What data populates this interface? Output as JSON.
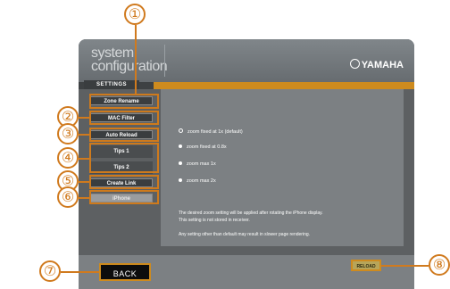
{
  "header": {
    "title_line1": "system",
    "title_line2": "configuration",
    "brand": "YAMAHA"
  },
  "tab": {
    "label": "SETTINGS"
  },
  "sidebar": {
    "items": [
      {
        "label": "Zone Rename"
      },
      {
        "label": "MAC Filter"
      },
      {
        "label": "Auto Reload"
      },
      {
        "label": "Tips 1"
      },
      {
        "label": "Tips 2"
      },
      {
        "label": "Create Link"
      },
      {
        "label": "iPhone"
      }
    ]
  },
  "options": [
    {
      "label": "zoom fixed at 1x (default)",
      "selected": true
    },
    {
      "label": "zoom fixed at 0.8x",
      "selected": false
    },
    {
      "label": "zoom max 1x",
      "selected": false
    },
    {
      "label": "zoom max 2x",
      "selected": false
    }
  ],
  "notes": [
    "The desired zoom setting will be applied after rotating the iPhone display.",
    "This setting is not stored in receiver.",
    "Any setting other than default may result in slower page rendering."
  ],
  "buttons": {
    "back": "BACK",
    "reload": "RELOAD"
  },
  "callouts": [
    "①",
    "②",
    "③",
    "④",
    "⑤",
    "⑥",
    "⑦",
    "⑧"
  ],
  "colors": {
    "accent": "#ce8b1e",
    "panel": "#5d6062",
    "content": "#7c8083"
  }
}
